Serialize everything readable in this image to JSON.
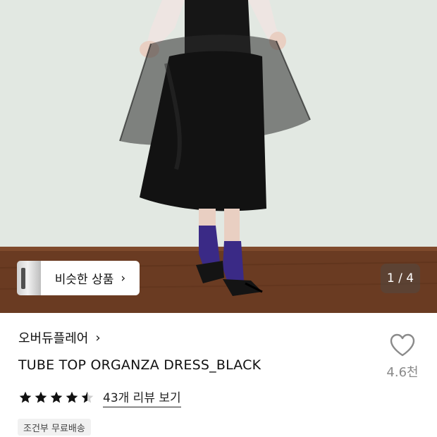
{
  "product_image": {
    "icon": "dress-photo",
    "pager": {
      "current": "1",
      "separator": "/",
      "total": "4",
      "text": "1 / 4"
    }
  },
  "similar_products": {
    "label": "비슷한 상품",
    "chevron": "›"
  },
  "brand": {
    "name": "오버듀플레어",
    "chevron": "›"
  },
  "product": {
    "title": "TUBE TOP ORGANZA DRESS_BLACK"
  },
  "like": {
    "icon": "heart-outline-icon",
    "count": "4.6천"
  },
  "rating": {
    "value": 4.5,
    "max": 5,
    "review_link": "43개 리뷰 보기"
  },
  "shipping_badge": "조건부 무료배송",
  "colors": {
    "star": "#111111",
    "star_empty": "#cfcfcf",
    "muted": "#8a8a8a",
    "badge_bg": "#f1f1f1"
  }
}
